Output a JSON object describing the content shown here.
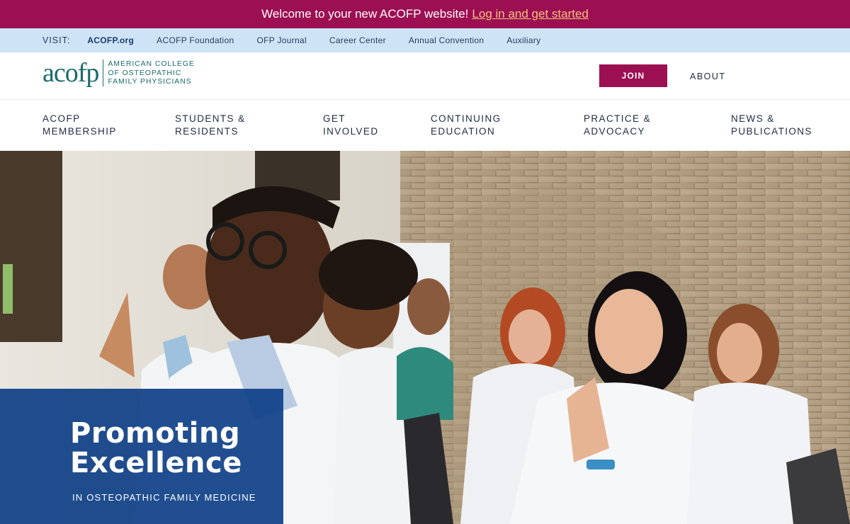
{
  "announcement": {
    "text": "Welcome to your new ACOFP website!",
    "link_text": "Log in and get started"
  },
  "visit_bar": {
    "label": "VISIT:",
    "links": [
      "ACOFP.org",
      "ACOFP Foundation",
      "OFP Journal",
      "Career Center",
      "Annual Convention",
      "Auxiliary"
    ]
  },
  "header": {
    "logo_mark": "acofp",
    "logo_lines": [
      "AMERICAN COLLEGE",
      "OF OSTEOPATHIC",
      "FAMILY PHYSICIANS"
    ],
    "join_label": "JOIN",
    "about_label": "ABOUT"
  },
  "main_nav": [
    {
      "line1": "ACOFP",
      "line2": "MEMBERSHIP"
    },
    {
      "line1": "STUDENTS &",
      "line2": "RESIDENTS"
    },
    {
      "line1": "GET",
      "line2": "INVOLVED"
    },
    {
      "line1": "CONTINUING",
      "line2": "EDUCATION"
    },
    {
      "line1": "PRACTICE &",
      "line2": "ADVOCACY"
    },
    {
      "line1": "NEWS &",
      "line2": "PUBLICATIONS"
    }
  ],
  "hero": {
    "title_line1": "Promoting",
    "title_line2": "Excellence",
    "subtitle": "IN OSTEOPATHIC FAMILY MEDICINE"
  },
  "colors": {
    "brand_magenta": "#9c0f52",
    "visit_bar_bg": "#cfe3f6",
    "logo_teal": "#1b6a6b",
    "hero_panel_blue": "#0e3f87",
    "link_gold": "#f4c27a"
  }
}
